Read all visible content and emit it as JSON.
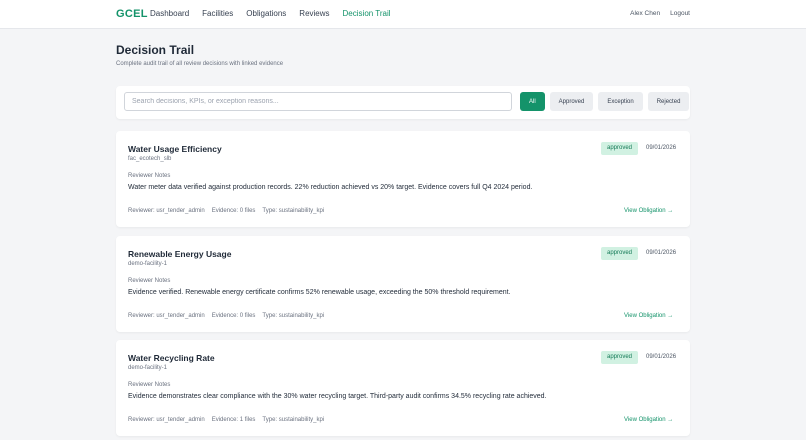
{
  "header": {
    "brand": "GCEL",
    "nav": [
      "Dashboard",
      "Facilities",
      "Obligations",
      "Reviews",
      "Decision Trail"
    ],
    "active_nav": "Decision Trail",
    "user_name": "Alex Chen",
    "logout_label": "Logout"
  },
  "page": {
    "title": "Decision Trail",
    "subtitle": "Complete audit trail of all review decisions with linked evidence"
  },
  "search": {
    "placeholder": "Search decisions, KPIs, or exception reasons...",
    "value": ""
  },
  "filters": {
    "items": [
      "All",
      "Approved",
      "Exception",
      "Rejected"
    ],
    "active": "All"
  },
  "decisions": [
    {
      "title": "Water Usage Efficiency",
      "facility": "fac_ecotech_slb",
      "status": "approved",
      "date": "09/01/2026",
      "notes_label": "Reviewer Notes",
      "notes": "Water meter data verified against production records. 22% reduction achieved vs 20% target. Evidence covers full Q4 2024 period.",
      "reviewer": "Reviewer: usr_tender_admin",
      "evidence": "Evidence: 0 files",
      "type": "Type: sustainability_kpi",
      "link": "View Obligation →"
    },
    {
      "title": "Renewable Energy Usage",
      "facility": "demo-facility-1",
      "status": "approved",
      "date": "09/01/2026",
      "notes_label": "Reviewer Notes",
      "notes": "Evidence verified. Renewable energy certificate confirms 52% renewable usage, exceeding the 50% threshold requirement.",
      "reviewer": "Reviewer: usr_tender_admin",
      "evidence": "Evidence: 0 files",
      "type": "Type: sustainability_kpi",
      "link": "View Obligation →"
    },
    {
      "title": "Water Recycling Rate",
      "facility": "demo-facility-1",
      "status": "approved",
      "date": "09/01/2026",
      "notes_label": "Reviewer Notes",
      "notes": "Evidence demonstrates clear compliance with the 30% water recycling target. Third-party audit confirms 34.5% recycling rate achieved.",
      "reviewer": "Reviewer: usr_tender_admin",
      "evidence": "Evidence: 1 files",
      "type": "Type: sustainability_kpi",
      "link": "View Obligation →"
    }
  ],
  "colors": {
    "accent": "#14936a",
    "badge_bg": "#d1f1e2",
    "page_bg": "#f4f5f7"
  }
}
